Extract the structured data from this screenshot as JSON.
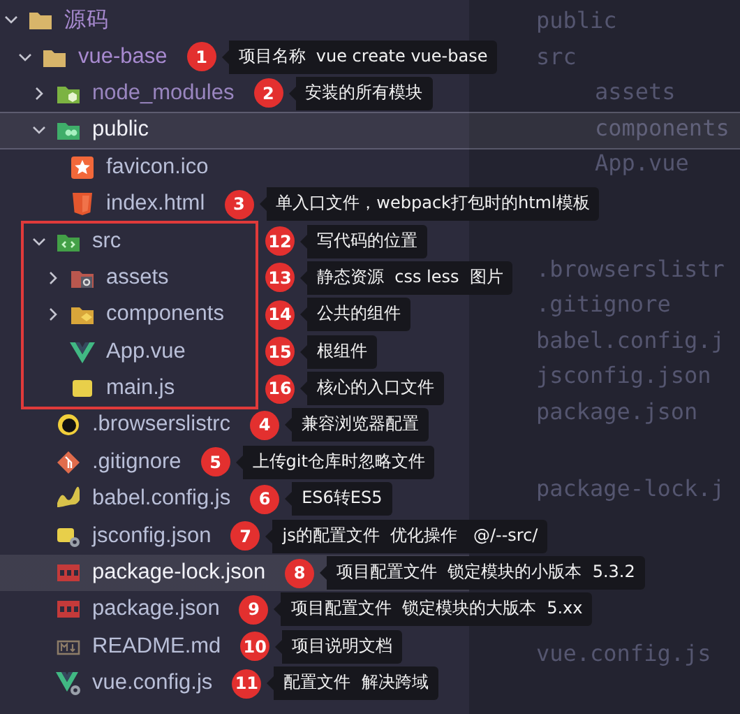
{
  "explorer": {
    "tree": [
      {
        "label": "源码",
        "kind": "folder",
        "color": "#a88ad0",
        "expanded": true,
        "selected": false,
        "hovered": false,
        "children": [
          {
            "label": "vue-base",
            "kind": "folder",
            "color": "#a88ad0",
            "expanded": true,
            "selected": false,
            "hovered": false,
            "note": {
              "number": "1",
              "text": "项目名称  vue create vue-base"
            },
            "children": [
              {
                "label": "node_modules",
                "kind": "node",
                "color": "#9a86c0",
                "expanded": false,
                "selected": false,
                "hovered": false,
                "note": {
                  "number": "2",
                  "text": "安装的所有模块"
                }
              },
              {
                "label": "public",
                "kind": "public",
                "color": "#f2f2f8",
                "expanded": true,
                "selected": true,
                "hovered": false,
                "children": [
                  {
                    "label": "favicon.ico",
                    "kind": "favicon",
                    "color": "#b9bfd8",
                    "selected": false,
                    "hovered": false
                  },
                  {
                    "label": "index.html",
                    "kind": "html",
                    "color": "#b9bfd8",
                    "selected": false,
                    "hovered": false,
                    "note": {
                      "number": "3",
                      "text": "单入口文件，webpack打包时的html模板"
                    }
                  }
                ]
              },
              {
                "label": "src",
                "kind": "src",
                "color": "#b9bfd8",
                "expanded": true,
                "selected": false,
                "hovered": false,
                "highlighted": true,
                "note": {
                  "number": "12",
                  "text": "写代码的位置"
                },
                "children": [
                  {
                    "label": "assets",
                    "kind": "assets",
                    "color": "#b9bfd8",
                    "expanded": false,
                    "selected": false,
                    "hovered": false,
                    "note": {
                      "number": "13",
                      "text": "静态资源  css less  图片"
                    }
                  },
                  {
                    "label": "components",
                    "kind": "components",
                    "color": "#b9bfd8",
                    "expanded": false,
                    "selected": false,
                    "hovered": false,
                    "note": {
                      "number": "14",
                      "text": "公共的组件"
                    }
                  },
                  {
                    "label": "App.vue",
                    "kind": "vue",
                    "color": "#b9bfd8",
                    "selected": false,
                    "hovered": false,
                    "note": {
                      "number": "15",
                      "text": "根组件"
                    }
                  },
                  {
                    "label": "main.js",
                    "kind": "js",
                    "color": "#b9bfd8",
                    "selected": false,
                    "hovered": false,
                    "note": {
                      "number": "16",
                      "text": "核心的入口文件"
                    }
                  }
                ]
              },
              {
                "label": ".browserslistrc",
                "kind": "browserslist",
                "color": "#b9bfd8",
                "selected": false,
                "hovered": false,
                "note": {
                  "number": "4",
                  "text": "兼容浏览器配置"
                }
              },
              {
                "label": ".gitignore",
                "kind": "git",
                "color": "#b9bfd8",
                "selected": false,
                "hovered": false,
                "note": {
                  "number": "5",
                  "text": "上传git仓库时忽略文件"
                }
              },
              {
                "label": "babel.config.js",
                "kind": "babel",
                "color": "#b9bfd8",
                "selected": false,
                "hovered": false,
                "note": {
                  "number": "6",
                  "text": "ES6转ES5"
                }
              },
              {
                "label": "jsconfig.json",
                "kind": "jsconfig",
                "color": "#b9bfd8",
                "selected": false,
                "hovered": false,
                "note": {
                  "number": "7",
                  "text": "js的配置文件  优化操作   @/--src/"
                }
              },
              {
                "label": "package-lock.json",
                "kind": "npm",
                "color": "#f2f2f8",
                "selected": false,
                "hovered": true,
                "note": {
                  "number": "8",
                  "text": "项目配置文件  锁定模块的小版本  5.3.2"
                }
              },
              {
                "label": "package.json",
                "kind": "npm",
                "color": "#b9bfd8",
                "selected": false,
                "hovered": false,
                "note": {
                  "number": "9",
                  "text": "项目配置文件  锁定模块的大版本  5.xx"
                }
              },
              {
                "label": "README.md",
                "kind": "markdown",
                "color": "#b9bfd8",
                "selected": false,
                "hovered": false,
                "note": {
                  "number": "10",
                  "text": "项目说明文档"
                }
              },
              {
                "label": "vue.config.js",
                "kind": "vueconfig",
                "color": "#b9bfd8",
                "selected": false,
                "hovered": false,
                "note": {
                  "number": "11",
                  "text": "配置文件  解决跨域"
                }
              }
            ]
          }
        ]
      }
    ]
  },
  "background_panel": {
    "blocks": [
      {
        "indented": false,
        "lines": [
          "public",
          "src"
        ]
      },
      {
        "indented": true,
        "lines": [
          "assets",
          "components",
          "App.vue"
        ]
      },
      {
        "indented": false,
        "lines": [
          ".browserslistr",
          ".gitignore",
          "babel.config.j",
          "jsconfig.json",
          "package.json"
        ]
      },
      {
        "indented": false,
        "lines": [
          "package-lock.j"
        ]
      },
      {
        "indented": false,
        "lines": [
          "vue.config.js"
        ]
      }
    ]
  }
}
